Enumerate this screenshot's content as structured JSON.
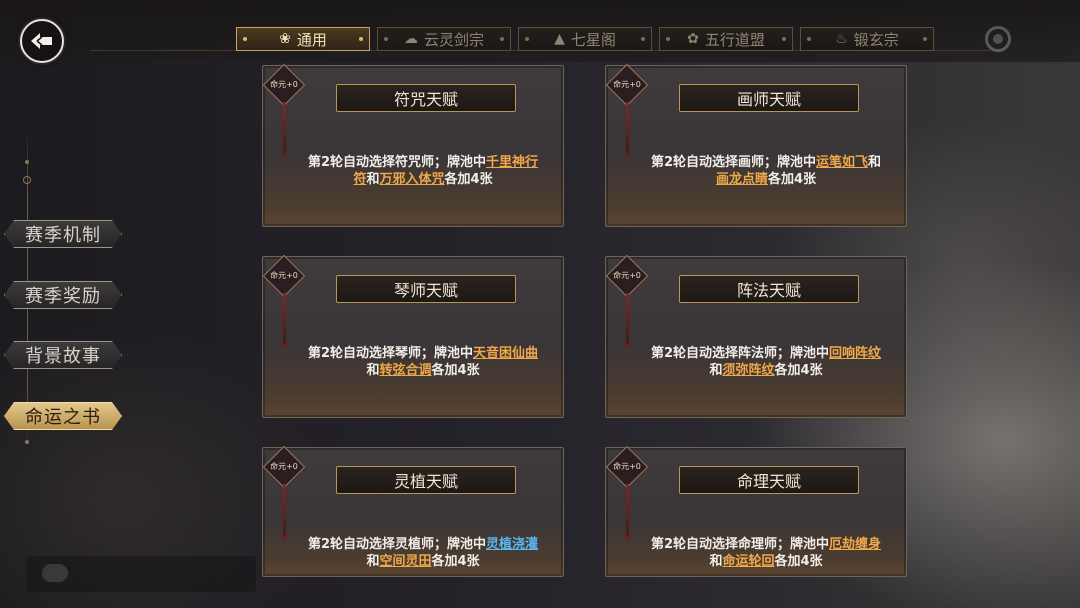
{
  "tabs": [
    {
      "label": "通用",
      "icon": "lotus-icon",
      "active": true
    },
    {
      "label": "云灵剑宗",
      "icon": "cloud-icon",
      "active": false
    },
    {
      "label": "七星阁",
      "icon": "pagoda-icon",
      "active": false
    },
    {
      "label": "五行道盟",
      "icon": "five-elements-icon",
      "active": false
    },
    {
      "label": "锻玄宗",
      "icon": "flame-icon",
      "active": false
    }
  ],
  "sidebar": {
    "items": [
      {
        "label": "赛季机制",
        "active": false
      },
      {
        "label": "赛季奖励",
        "active": false
      },
      {
        "label": "背景故事",
        "active": false
      },
      {
        "label": "命运之书",
        "active": true
      }
    ]
  },
  "cards": [
    {
      "tag": "命元+0",
      "title": "符咒天赋",
      "desc_pre": "第2轮自动选择符咒师；牌池中",
      "hl1": "千里神行符",
      "mid": "和",
      "hl2": "万邪入体咒",
      "desc_post": "各加4张",
      "hl_color": "orange"
    },
    {
      "tag": "命元+0",
      "title": "画师天赋",
      "desc_pre": "第2轮自动选择画师；牌池中",
      "hl1": "运笔如飞",
      "mid": "和",
      "hl2": "画龙点睛",
      "desc_post": "各加4张",
      "hl_color": "orange"
    },
    {
      "tag": "命元+0",
      "title": "琴师天赋",
      "desc_pre": "第2轮自动选择琴师；牌池中",
      "hl1": "天音困仙曲",
      "mid": "和",
      "hl2": "转弦合调",
      "desc_post": "各加4张",
      "hl_color": "orange"
    },
    {
      "tag": "命元+0",
      "title": "阵法天赋",
      "desc_pre": "第2轮自动选择阵法师；牌池中",
      "hl1": "回响阵纹",
      "mid": "和",
      "hl2": "须弥阵纹",
      "desc_post": "各加4张",
      "hl_color": "orange"
    },
    {
      "tag": "命元+0",
      "title": "灵植天赋",
      "desc_pre": "第2轮自动选择灵植师；牌池中",
      "hl1": "灵植浇灌",
      "mid": "和",
      "hl2": "空间灵田",
      "desc_post": "各加4张",
      "hl_color": "blue-orange"
    },
    {
      "tag": "命元+0",
      "title": "命理天赋",
      "desc_pre": "第2轮自动选择命理师；牌池中",
      "hl1": "厄劫缠身",
      "mid": "和",
      "hl2": "命运轮回",
      "desc_post": "各加4张",
      "hl_color": "orange"
    }
  ],
  "colors": {
    "accent": "#c9a45f",
    "highlight_orange": "#f0a848",
    "highlight_blue": "#5ab8f0"
  }
}
